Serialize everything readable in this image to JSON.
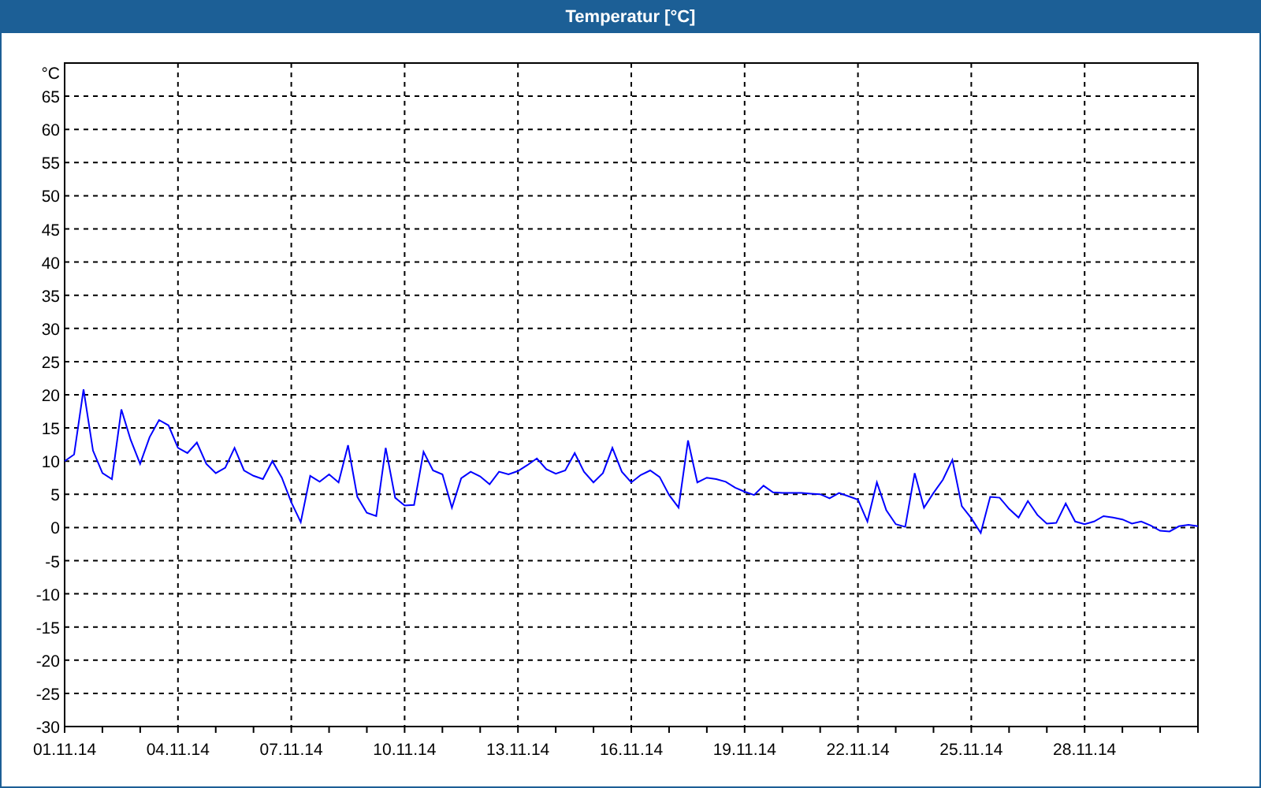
{
  "chart": {
    "chart_data": {
      "type": "line",
      "title": "Temperatur [°C]",
      "ylabel": "°C",
      "categories": [
        "01.11.14",
        null,
        null,
        null,
        null,
        null,
        null,
        null,
        null,
        null,
        null,
        null,
        "04.11.14",
        null,
        null,
        null,
        null,
        null,
        null,
        null,
        null,
        null,
        null,
        null,
        "07.11.14",
        null,
        null,
        null,
        null,
        null,
        null,
        null,
        null,
        null,
        null,
        null,
        "10.11.14",
        null,
        null,
        null,
        null,
        null,
        null,
        null,
        null,
        null,
        null,
        null,
        "13.11.14",
        null,
        null,
        null,
        null,
        null,
        null,
        null,
        null,
        null,
        null,
        null,
        "16.11.14",
        null,
        null,
        null,
        null,
        null,
        null,
        null,
        null,
        null,
        null,
        null,
        "19.11.14",
        null,
        null,
        null,
        null,
        null,
        null,
        null,
        null,
        null,
        null,
        null,
        "22.11.14",
        null,
        null,
        null,
        null,
        null,
        null,
        null,
        null,
        null,
        null,
        null,
        "25.11.14",
        null,
        null,
        null,
        null,
        null,
        null,
        null,
        null,
        null,
        null,
        null,
        "28.11.14",
        null,
        null,
        null,
        null,
        null,
        null,
        null,
        null,
        null,
        null,
        null,
        null
      ],
      "series": [
        {
          "color": "#0000ff",
          "values": [
            10,
            11,
            20.8,
            11.6,
            8.2,
            7.3,
            17.8,
            13.2,
            9.6,
            13.6,
            16.2,
            15.4,
            12,
            11.2,
            12.8,
            9.6,
            8.2,
            9,
            12,
            8.6,
            7.8,
            7.3,
            10,
            7.5,
            3.8,
            0.8,
            7.8,
            6.9,
            8,
            6.8,
            12.4,
            4.6,
            2.2,
            1.7,
            12,
            4.5,
            3.3,
            3.4,
            11.4,
            8.6,
            8,
            3,
            7.4,
            8.4,
            7.7,
            6.5,
            8.4,
            8,
            8.5,
            9.4,
            10.4,
            8.8,
            8.1,
            8.6,
            11.2,
            8.4,
            6.8,
            8.2,
            12,
            8.4,
            6.8,
            7.9,
            8.6,
            7.6,
            4.9,
            3,
            13.1,
            6.8,
            7.5,
            7.3,
            6.9,
            6,
            5.4,
            4.9,
            6.3,
            5.3,
            5.2,
            5.2,
            5.2,
            5.1,
            5,
            4.4,
            5.2,
            4.7,
            4.2,
            0.9,
            6.8,
            2.6,
            0.5,
            0.1,
            8.2,
            3,
            5.2,
            7.2,
            10.2,
            3.2,
            1.4,
            -0.8,
            4.6,
            4.5,
            2.8,
            1.5,
            4,
            1.9,
            0.6,
            0.7,
            3.6,
            0.9,
            0.5,
            0.9,
            1.7,
            1.5,
            1.2,
            0.6,
            0.9,
            0.3,
            -0.5,
            -0.6,
            0.2,
            0.4,
            0.2
          ]
        }
      ],
      "ylim": [
        -30,
        70
      ],
      "grid": true,
      "yticks": [
        -30,
        -25,
        -20,
        -15,
        -10,
        -5,
        0,
        5,
        10,
        15,
        20,
        25,
        30,
        35,
        40,
        45,
        50,
        55,
        60,
        65
      ]
    }
  }
}
